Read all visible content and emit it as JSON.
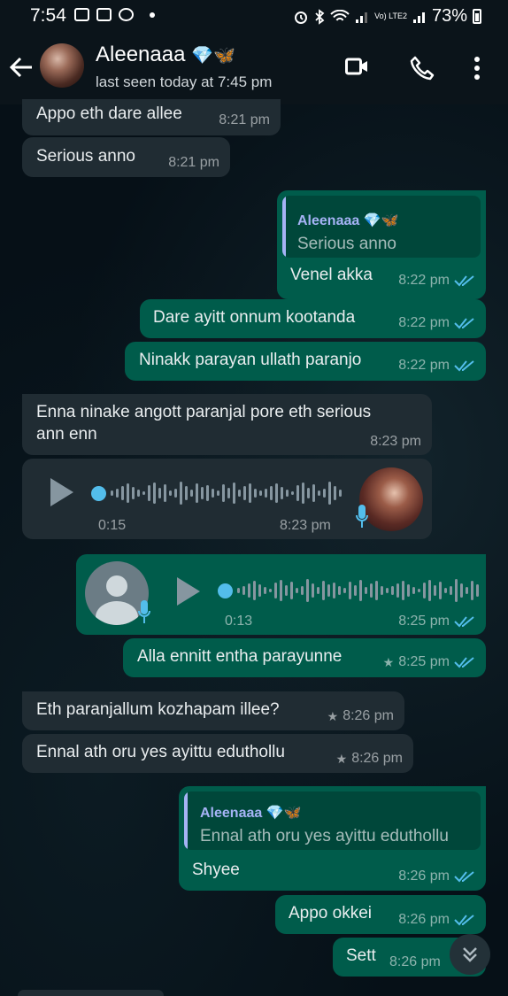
{
  "status_bar": {
    "time": "7:54",
    "network_label": "Vo) LTE2",
    "battery": "73%"
  },
  "header": {
    "contact_name": "Aleenaaa",
    "contact_emoji": "💎🦋",
    "last_seen": "last seen today at 7:45 pm",
    "icons": [
      "back-arrow-icon",
      "video-call-icon",
      "phone-call-icon",
      "more-options-icon"
    ]
  },
  "messages": [
    {
      "dir": "in",
      "text": "Appo eth dare allee",
      "time": "8:21 pm"
    },
    {
      "dir": "in",
      "text": "Serious anno",
      "time": "8:21 pm"
    },
    {
      "dir": "out",
      "quote_name": "Aleenaaa 💎🦋",
      "quote_text": "Serious anno",
      "text": "Venel akka",
      "time": "8:22 pm"
    },
    {
      "dir": "out",
      "text": "Dare ayitt  onnum kootanda",
      "time": "8:22 pm"
    },
    {
      "dir": "out",
      "text": "Ninakk parayan ullath paranjo",
      "time": "8:22 pm"
    },
    {
      "dir": "in",
      "text_line1": "Enna ninake angott paranjal pore eth serious",
      "text_line2": "ann enn",
      "time": "8:23 pm"
    },
    {
      "dir": "in",
      "type": "voice",
      "duration": "0:15",
      "time": "8:23 pm"
    },
    {
      "dir": "out",
      "type": "voice",
      "duration": "0:13",
      "time": "8:25 pm"
    },
    {
      "dir": "out",
      "text": "Alla ennitt entha parayunne",
      "time": "8:25 pm",
      "starred": true
    },
    {
      "dir": "in",
      "text": "Eth paranjallum kozhapam illee?",
      "time": "8:26 pm",
      "starred": true
    },
    {
      "dir": "in",
      "text": "Ennal ath oru yes ayittu eduthollu",
      "time": "8:26 pm",
      "starred": true
    },
    {
      "dir": "out",
      "quote_name": "Aleenaaa 💎🦋",
      "quote_text": "Ennal ath oru yes ayittu eduthollu",
      "text": "Shyee",
      "time": "8:26 pm"
    },
    {
      "dir": "out",
      "text": "Appo okkei",
      "time": "8:26 pm"
    },
    {
      "dir": "out",
      "text": "Sett",
      "time": "8:26 pm"
    }
  ],
  "colors": {
    "incoming": "#202c33",
    "outgoing": "#005c4b",
    "read_tick": "#53bdeb",
    "quote_accent": "#a5b3f5"
  },
  "star_glyph": "★"
}
